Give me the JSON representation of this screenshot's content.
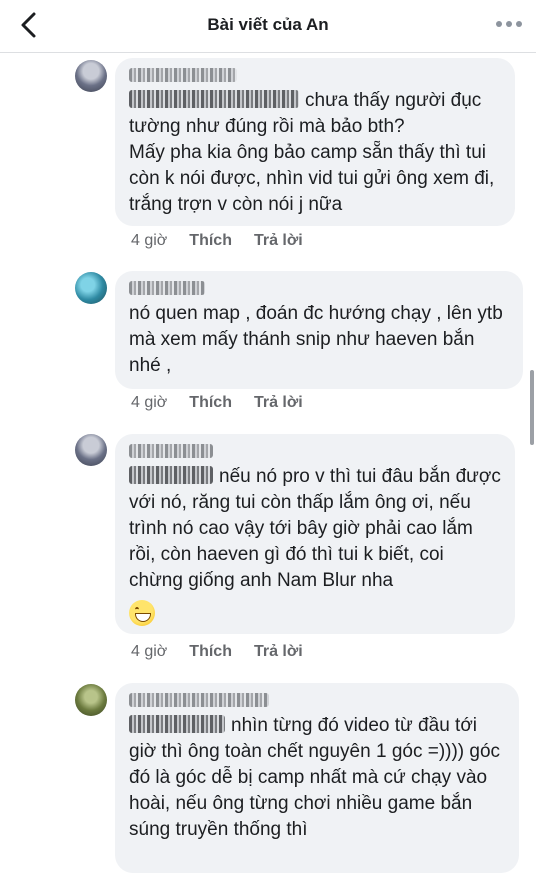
{
  "header": {
    "title": "Bài viết của An"
  },
  "comments": [
    {
      "text": "chưa thấy người đục tường như đúng rồi mà bảo bth?\nMấy pha kia ông bảo camp sẵn thấy thì tui còn k nói được, nhìn vid tui gửi ông xem đi, trắng trợn v còn nói j nữa",
      "time": "4 giờ",
      "like": "Thích",
      "reply": "Trả lời"
    },
    {
      "text": "nó quen map , đoán đc hướng chạy , lên ytb mà xem mấy thánh snip như haeven bắn nhé ,",
      "time": "4 giờ",
      "like": "Thích",
      "reply": "Trả lời"
    },
    {
      "text": "nếu nó pro v thì tui đâu bắn được với nó, răng tui còn thấp lắm ông ơi, nếu trình nó cao vậy tới bây giờ phải cao lắm rồi, còn haeven gì đó thì tui k biết, coi chừng giống anh Nam Blur nha",
      "emoji": "grinning-sweat-emoji",
      "time": "4 giờ",
      "like": "Thích",
      "reply": "Trả lời"
    },
    {
      "text": "nhìn từng đó video từ đầu tới giờ thì ông toàn chết nguyên 1 góc =)))) góc đó là góc dễ bị camp nhất mà cứ chạy vào hoài, nếu ông từng chơi nhiều game bắn súng truyền thống thì"
    }
  ],
  "colors": {
    "bubble": "#f0f2f5",
    "meta_text": "#65676b",
    "primary_text": "#1c1e21"
  }
}
